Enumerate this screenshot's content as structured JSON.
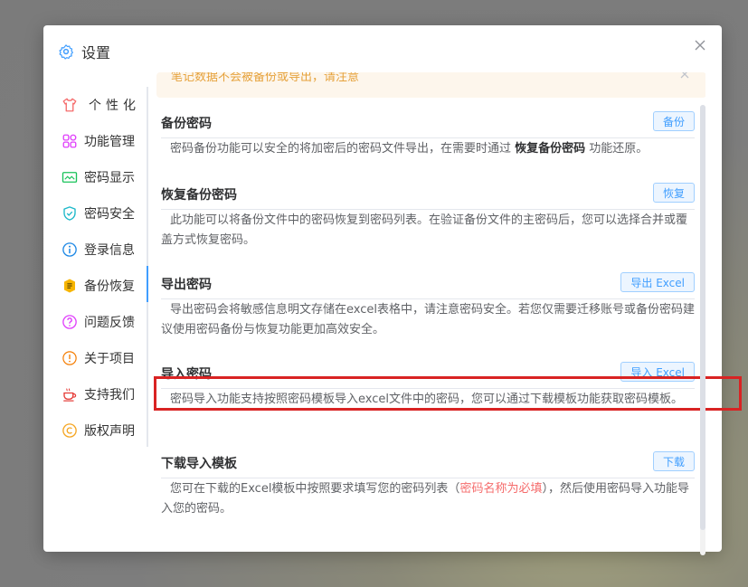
{
  "dialog": {
    "title": "设置"
  },
  "nav": {
    "items": [
      {
        "label": "个性化",
        "icon": "tshirt-icon"
      },
      {
        "label": "功能管理",
        "icon": "grid-icon"
      },
      {
        "label": "密码显示",
        "icon": "monitor-icon"
      },
      {
        "label": "密码安全",
        "icon": "shield-icon"
      },
      {
        "label": "登录信息",
        "icon": "info-icon"
      },
      {
        "label": "备份恢复",
        "icon": "backup-icon"
      },
      {
        "label": "问题反馈",
        "icon": "question-icon"
      },
      {
        "label": "关于项目",
        "icon": "about-icon"
      },
      {
        "label": "支持我们",
        "icon": "coffee-icon"
      },
      {
        "label": "版权声明",
        "icon": "copyright-icon"
      }
    ],
    "active": "备份恢复"
  },
  "notice": {
    "text": "笔记数据不会被备份或导出，请注意"
  },
  "sections": {
    "backup": {
      "title": "备份密码",
      "button": "备份",
      "desc_pre": "密码备份功能可以安全的将加密后的密码文件导出，在需要时通过 ",
      "desc_strong": "恢复备份密码",
      "desc_post": " 功能还原。"
    },
    "restore": {
      "title": "恢复备份密码",
      "button": "恢复",
      "desc": "此功能可以将备份文件中的密码恢复到密码列表。在验证备份文件的主密码后，您可以选择合并或覆盖方式恢复密码。"
    },
    "export": {
      "title": "导出密码",
      "button": "导出 Excel",
      "desc": "导出密码会将敏感信息明文存储在excel表格中，请注意密码安全。若您仅需要迁移账号或备份密码建议使用密码备份与恢复功能更加高效安全。"
    },
    "import": {
      "title": "导入密码",
      "button": "导入 Excel",
      "desc": "密码导入功能支持按照密码模板导入excel文件中的密码，您可以通过下载模板功能获取密码模板。"
    },
    "template": {
      "title": "下载导入模板",
      "button": "下载",
      "desc_pre": "您可在下载的Excel模板中按照要求填写您的密码列表（",
      "desc_warn": "密码名称为必填",
      "desc_post": "），然后使用密码导入功能导入您的密码。"
    }
  },
  "colors": {
    "accent": "#409eff",
    "highlight": "#d92323",
    "warn": "#f56c6c",
    "notice": "#e6a23c"
  }
}
